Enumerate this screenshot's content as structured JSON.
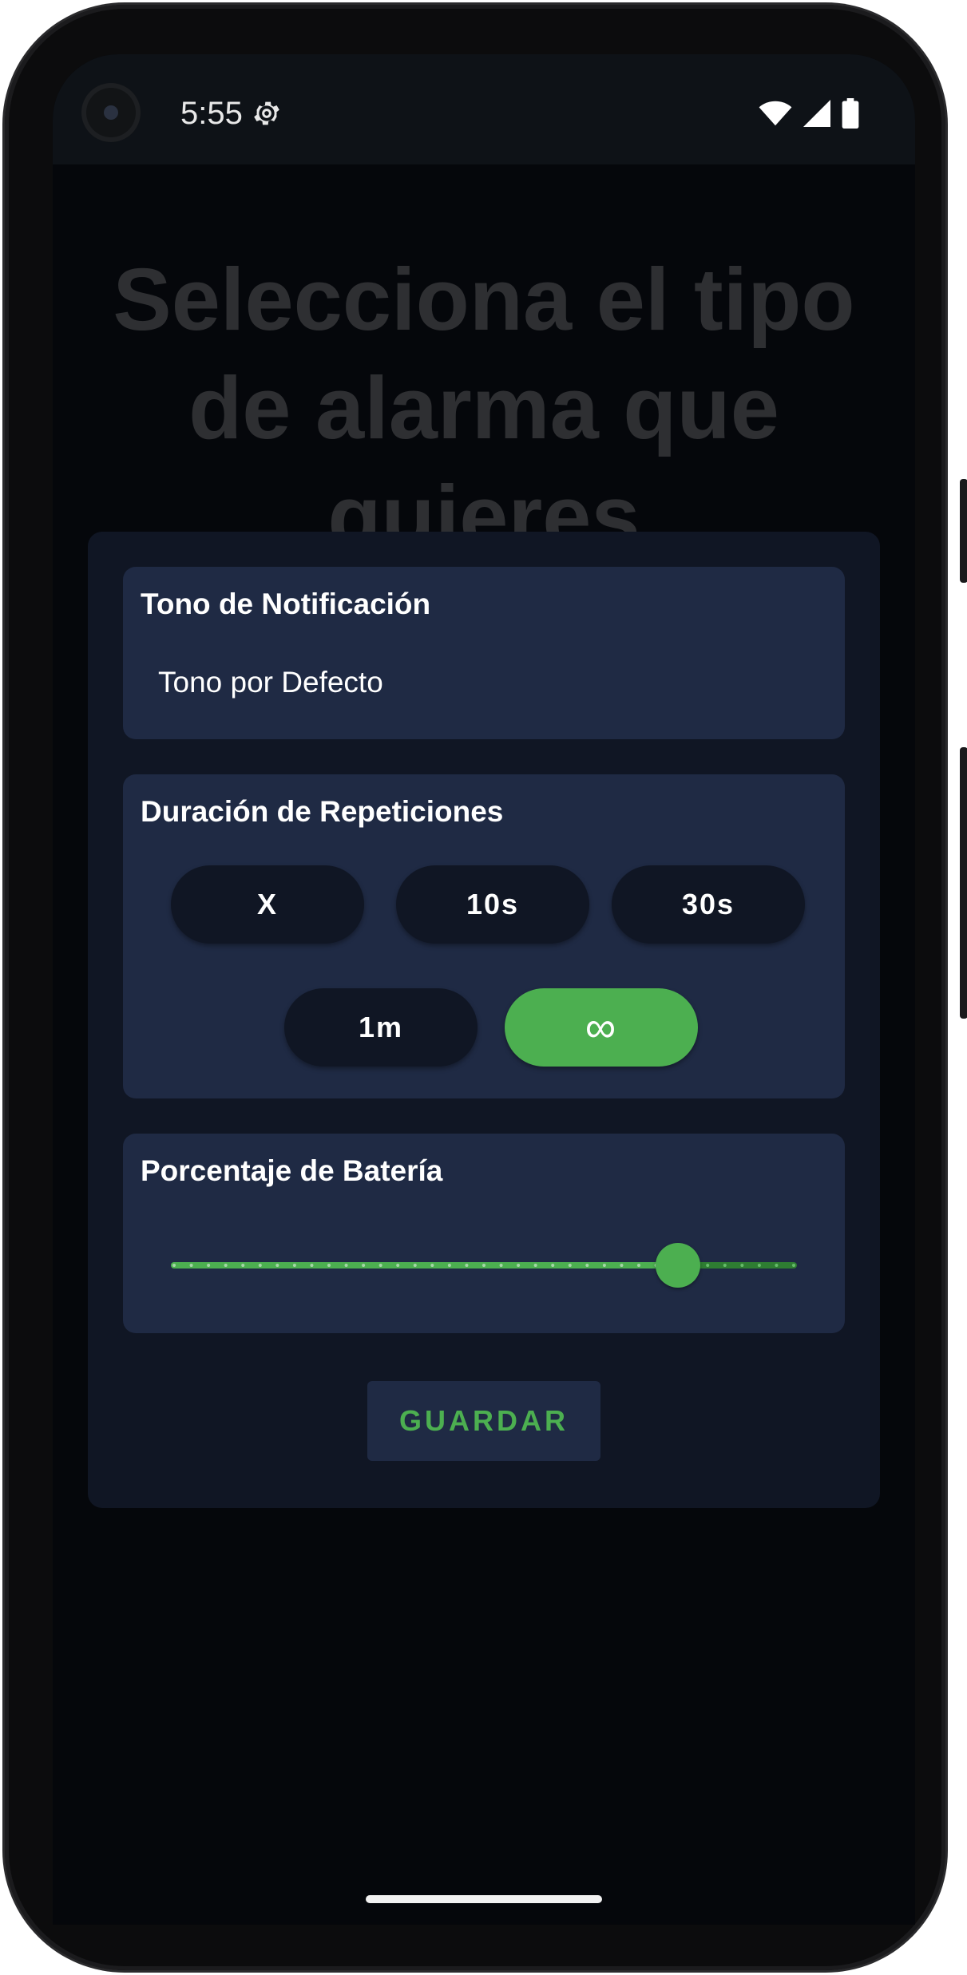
{
  "status_bar": {
    "time": "5:55",
    "icons": [
      "settings-gear-icon",
      "wifi-icon",
      "cellular-signal-icon",
      "battery-icon"
    ]
  },
  "background": {
    "headline": "Selecciona el tipo de alarma que quieres"
  },
  "dialog": {
    "notification_tone": {
      "title": "Tono de Notificación",
      "value": "Tono por Defecto"
    },
    "repeat_duration": {
      "title": "Duración de Repeticiones",
      "options": [
        "X",
        "10s",
        "30s",
        "1m",
        "∞"
      ],
      "selected": "∞"
    },
    "battery_percentage": {
      "title": "Porcentaje de Batería",
      "slider_fraction": 0.81,
      "steps": 36
    },
    "save_label": "GUARDAR"
  },
  "colors": {
    "accent": "#4caf50",
    "card": "#1f2a44",
    "dialog": "#101624",
    "background": "#05070b"
  }
}
